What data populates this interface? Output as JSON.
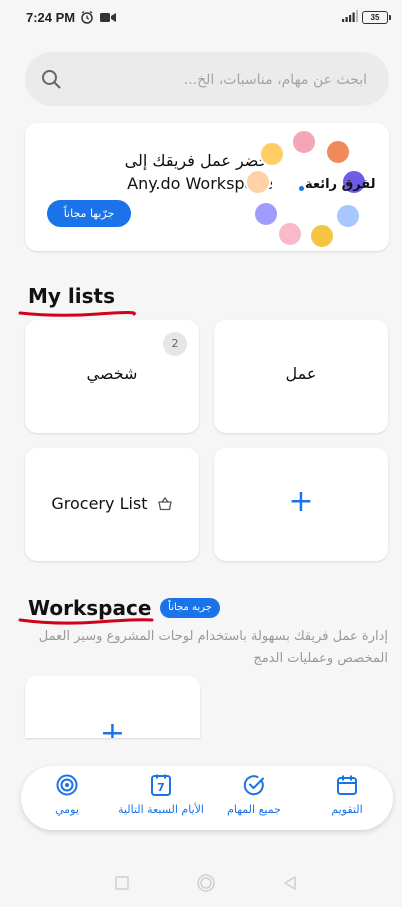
{
  "status_bar": {
    "time": "7:24 PM",
    "battery": "35"
  },
  "search": {
    "placeholder": "ابحث عن مهام، مناسبات، الخ..."
  },
  "promo": {
    "line1": "أحضر عمل فريقك إلى",
    "line2": "Any.do Workspace",
    "button": "جرّبها مجاناً",
    "ring_label": "لفرق رائعة"
  },
  "my_lists": {
    "title": "My lists",
    "lists": [
      {
        "label": "عمل",
        "count": ""
      },
      {
        "label": "شخصي",
        "count": "2"
      },
      {
        "label": "Grocery List",
        "icon": "basket-icon"
      }
    ],
    "add_symbol": "+"
  },
  "workspace": {
    "title": "Workspace",
    "badge": "جربه مجاناً",
    "description": "إدارة عمل فريقك بسهولة باستخدام لوحات المشروع وسير العمل المخصص وعمليات الدمج",
    "add_symbol": "+"
  },
  "bottom_nav": {
    "items": [
      {
        "label": "التقويم",
        "icon": "calendar-icon"
      },
      {
        "label": "جميع المهام",
        "icon": "check-circle-icon"
      },
      {
        "label": "الأيام السبعة التالية",
        "icon": "calendar-seven-icon",
        "day": "7"
      },
      {
        "label": "يومي",
        "icon": "target-icon"
      }
    ]
  },
  "colors": {
    "accent": "#1a73e8",
    "annotation_red": "#d0021b"
  }
}
